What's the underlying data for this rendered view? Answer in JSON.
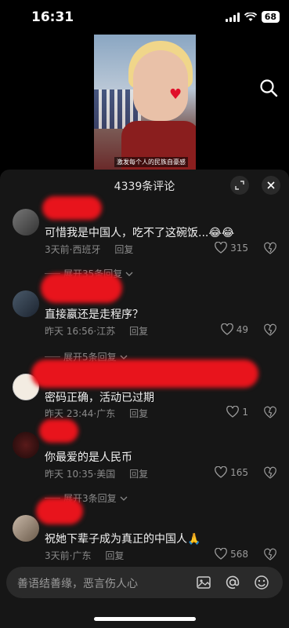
{
  "status_bar": {
    "time": "16:31",
    "battery": "68"
  },
  "video": {
    "caption": "激发每个人的民族自豪感"
  },
  "comments_panel": {
    "title": "4339条评论",
    "comments": [
      {
        "text": "可惜我是中国人，吃不了这碗饭...😂😂",
        "time": "3天前",
        "location": "西班牙",
        "reply": "回复",
        "likes": "315",
        "expand": "展开35条回复"
      },
      {
        "text": "直接嬴还是走程序？",
        "time": "昨天 16:56",
        "location": "江苏",
        "reply": "回复",
        "likes": "49",
        "expand": "展开5条回复"
      },
      {
        "text": "密码正确，活动已过期",
        "time": "昨天 23:44",
        "location": "广东",
        "reply": "回复",
        "likes": "1",
        "expand": ""
      },
      {
        "text": "你最爱的是人民币",
        "time": "昨天 10:35",
        "location": "美国",
        "reply": "回复",
        "likes": "165",
        "expand": "展开3条回复"
      },
      {
        "text": "祝她下辈子成为真正的中国人🙏",
        "time": "3天前",
        "location": "广东",
        "reply": "回复",
        "likes": "568",
        "expand": ""
      }
    ]
  },
  "input": {
    "placeholder": "善语结善缘，恶言伤人心"
  },
  "icons": [
    "search-icon",
    "expand-icon",
    "close-icon",
    "heart-icon",
    "dislike-icon",
    "chevron-down-icon",
    "image-icon",
    "at-icon",
    "emoji-icon"
  ]
}
